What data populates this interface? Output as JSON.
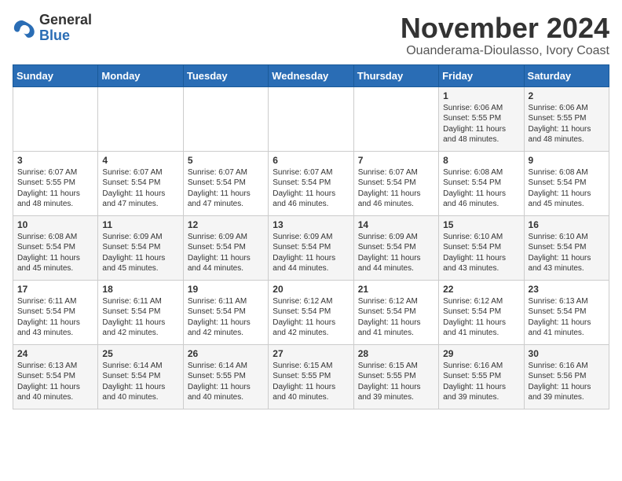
{
  "header": {
    "logo": {
      "general": "General",
      "blue": "Blue"
    },
    "month": "November 2024",
    "location": "Ouanderama-Dioulasso, Ivory Coast"
  },
  "weekdays": [
    "Sunday",
    "Monday",
    "Tuesday",
    "Wednesday",
    "Thursday",
    "Friday",
    "Saturday"
  ],
  "weeks": [
    [
      {
        "day": "",
        "info": ""
      },
      {
        "day": "",
        "info": ""
      },
      {
        "day": "",
        "info": ""
      },
      {
        "day": "",
        "info": ""
      },
      {
        "day": "",
        "info": ""
      },
      {
        "day": "1",
        "info": "Sunrise: 6:06 AM\nSunset: 5:55 PM\nDaylight: 11 hours\nand 48 minutes."
      },
      {
        "day": "2",
        "info": "Sunrise: 6:06 AM\nSunset: 5:55 PM\nDaylight: 11 hours\nand 48 minutes."
      }
    ],
    [
      {
        "day": "3",
        "info": "Sunrise: 6:07 AM\nSunset: 5:55 PM\nDaylight: 11 hours\nand 48 minutes."
      },
      {
        "day": "4",
        "info": "Sunrise: 6:07 AM\nSunset: 5:54 PM\nDaylight: 11 hours\nand 47 minutes."
      },
      {
        "day": "5",
        "info": "Sunrise: 6:07 AM\nSunset: 5:54 PM\nDaylight: 11 hours\nand 47 minutes."
      },
      {
        "day": "6",
        "info": "Sunrise: 6:07 AM\nSunset: 5:54 PM\nDaylight: 11 hours\nand 46 minutes."
      },
      {
        "day": "7",
        "info": "Sunrise: 6:07 AM\nSunset: 5:54 PM\nDaylight: 11 hours\nand 46 minutes."
      },
      {
        "day": "8",
        "info": "Sunrise: 6:08 AM\nSunset: 5:54 PM\nDaylight: 11 hours\nand 46 minutes."
      },
      {
        "day": "9",
        "info": "Sunrise: 6:08 AM\nSunset: 5:54 PM\nDaylight: 11 hours\nand 45 minutes."
      }
    ],
    [
      {
        "day": "10",
        "info": "Sunrise: 6:08 AM\nSunset: 5:54 PM\nDaylight: 11 hours\nand 45 minutes."
      },
      {
        "day": "11",
        "info": "Sunrise: 6:09 AM\nSunset: 5:54 PM\nDaylight: 11 hours\nand 45 minutes."
      },
      {
        "day": "12",
        "info": "Sunrise: 6:09 AM\nSunset: 5:54 PM\nDaylight: 11 hours\nand 44 minutes."
      },
      {
        "day": "13",
        "info": "Sunrise: 6:09 AM\nSunset: 5:54 PM\nDaylight: 11 hours\nand 44 minutes."
      },
      {
        "day": "14",
        "info": "Sunrise: 6:09 AM\nSunset: 5:54 PM\nDaylight: 11 hours\nand 44 minutes."
      },
      {
        "day": "15",
        "info": "Sunrise: 6:10 AM\nSunset: 5:54 PM\nDaylight: 11 hours\nand 43 minutes."
      },
      {
        "day": "16",
        "info": "Sunrise: 6:10 AM\nSunset: 5:54 PM\nDaylight: 11 hours\nand 43 minutes."
      }
    ],
    [
      {
        "day": "17",
        "info": "Sunrise: 6:11 AM\nSunset: 5:54 PM\nDaylight: 11 hours\nand 43 minutes."
      },
      {
        "day": "18",
        "info": "Sunrise: 6:11 AM\nSunset: 5:54 PM\nDaylight: 11 hours\nand 42 minutes."
      },
      {
        "day": "19",
        "info": "Sunrise: 6:11 AM\nSunset: 5:54 PM\nDaylight: 11 hours\nand 42 minutes."
      },
      {
        "day": "20",
        "info": "Sunrise: 6:12 AM\nSunset: 5:54 PM\nDaylight: 11 hours\nand 42 minutes."
      },
      {
        "day": "21",
        "info": "Sunrise: 6:12 AM\nSunset: 5:54 PM\nDaylight: 11 hours\nand 41 minutes."
      },
      {
        "day": "22",
        "info": "Sunrise: 6:12 AM\nSunset: 5:54 PM\nDaylight: 11 hours\nand 41 minutes."
      },
      {
        "day": "23",
        "info": "Sunrise: 6:13 AM\nSunset: 5:54 PM\nDaylight: 11 hours\nand 41 minutes."
      }
    ],
    [
      {
        "day": "24",
        "info": "Sunrise: 6:13 AM\nSunset: 5:54 PM\nDaylight: 11 hours\nand 40 minutes."
      },
      {
        "day": "25",
        "info": "Sunrise: 6:14 AM\nSunset: 5:54 PM\nDaylight: 11 hours\nand 40 minutes."
      },
      {
        "day": "26",
        "info": "Sunrise: 6:14 AM\nSunset: 5:55 PM\nDaylight: 11 hours\nand 40 minutes."
      },
      {
        "day": "27",
        "info": "Sunrise: 6:15 AM\nSunset: 5:55 PM\nDaylight: 11 hours\nand 40 minutes."
      },
      {
        "day": "28",
        "info": "Sunrise: 6:15 AM\nSunset: 5:55 PM\nDaylight: 11 hours\nand 39 minutes."
      },
      {
        "day": "29",
        "info": "Sunrise: 6:16 AM\nSunset: 5:55 PM\nDaylight: 11 hours\nand 39 minutes."
      },
      {
        "day": "30",
        "info": "Sunrise: 6:16 AM\nSunset: 5:56 PM\nDaylight: 11 hours\nand 39 minutes."
      }
    ]
  ]
}
